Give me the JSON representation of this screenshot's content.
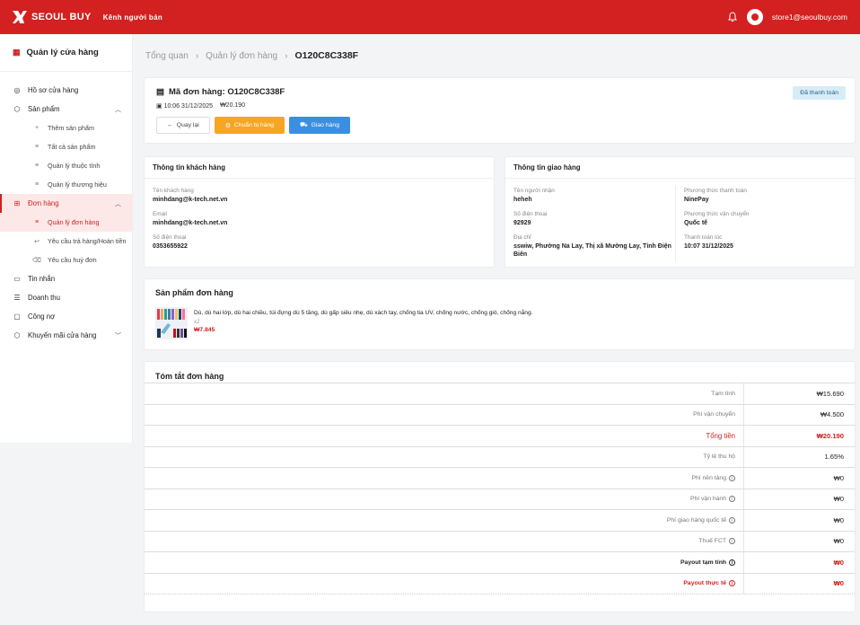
{
  "topbar": {
    "brand": "SEOUL BUY",
    "brand_sub": "Kênh người bán",
    "user_email": "store1@seoulbuy.com",
    "color": "#d32020"
  },
  "sidebar": {
    "title": "Quản lý cửa hàng",
    "items": [
      {
        "label": "Hồ sơ cửa hàng",
        "icon": "store-profile-icon"
      },
      {
        "label": "Sản phẩm",
        "icon": "product-icon"
      },
      {
        "label": "Thêm sản phẩm",
        "icon": "plus-icon"
      },
      {
        "label": "Tất cả sản phẩm",
        "icon": "list-icon"
      },
      {
        "label": "Quản lý thuộc tính",
        "icon": "list-icon"
      },
      {
        "label": "Quản lý thương hiệu",
        "icon": "list-icon"
      },
      {
        "label": "Đơn hàng",
        "icon": "cart-icon"
      },
      {
        "label": "Quản lý đơn hàng",
        "icon": "list-icon"
      },
      {
        "label": "Yêu cầu trả hàng/Hoàn tiền",
        "icon": "return-icon"
      },
      {
        "label": "Yêu cầu huỷ đơn",
        "icon": "trash-icon"
      },
      {
        "label": "Tin nhắn",
        "icon": "chat-icon"
      },
      {
        "label": "Doanh thu",
        "icon": "revenue-icon"
      },
      {
        "label": "Công nợ",
        "icon": "debt-icon"
      },
      {
        "label": "Khuyến mãi cửa hàng",
        "icon": "promo-icon"
      }
    ]
  },
  "breadcrumb": [
    "Tổng quan",
    "Quản lý đơn hàng",
    "O120C8C338F"
  ],
  "order": {
    "title": "Mã đơn hàng: O120C8C338F",
    "datetime": "10:06 31/12/2025",
    "amount": "₩20.190",
    "status": "Đã thanh toán",
    "back_label": "Quay lại",
    "prepare_label": "Chuẩn bị hàng",
    "ship_label": "Giao hàng"
  },
  "customer": {
    "heading": "Thông tin khách hàng",
    "name_label": "Tên khách hàng",
    "name": "minhdang@k-tech.net.vn",
    "email_label": "Email",
    "email": "minhdang@k-tech.net.vn",
    "phone_label": "Số điện thoại",
    "phone": "0353655922"
  },
  "shipping": {
    "heading": "Thông tin giao hàng",
    "recipient_label": "Tên người nhận",
    "recipient": "heheh",
    "phone_label": "Số điện thoại",
    "phone": "92929",
    "address_label": "Địa chỉ",
    "address": "sswiw, Phường Na Lay, Thị xã Mường Lay, Tỉnh Điện Biên",
    "pay_method_label": "Phương thức thanh toán",
    "pay_method": "NinePay",
    "ship_method_label": "Phương thức vận chuyển",
    "ship_method": "Quốc tế",
    "paid_at_label": "Thanh toán lúc",
    "paid_at": "10:07 31/12/2025"
  },
  "products": {
    "heading": "Sản phẩm đơn hàng",
    "items": [
      {
        "name": "Dù, dù hai lớp, dù hai chiều, túi đựng dù 5 tầng, dù gấp siêu nhẹ, dù xách tay, chống tia UV, chống nước, chống gió, chống nắng.",
        "qty": "x2",
        "price": "₩7.845"
      }
    ]
  },
  "summary": {
    "heading": "Tóm tắt đơn hàng",
    "rows": [
      {
        "label": "Tạm tính",
        "value": "₩15.690"
      },
      {
        "label": "Phí vận chuyển",
        "value": "₩4.500"
      },
      {
        "label": "Tổng tiền",
        "value": "₩20.190"
      },
      {
        "label": "Tỷ lệ thu hộ",
        "value": "1.65%"
      },
      {
        "label": "Phí nền tảng",
        "value": "₩0"
      },
      {
        "label": "Phí vận hành",
        "value": "₩0"
      },
      {
        "label": "Phí giao hàng quốc tế",
        "value": "₩0"
      },
      {
        "label": "Thuế FCT",
        "value": "₩0"
      },
      {
        "label": "Payout tạm tính",
        "value": "₩0"
      },
      {
        "label": "Payout thực tế",
        "value": "₩0"
      }
    ]
  }
}
